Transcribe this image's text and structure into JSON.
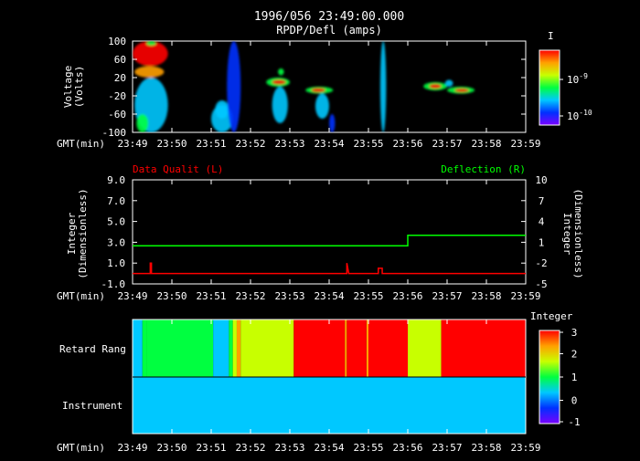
{
  "header": {
    "title": "1996/056 23:49:00.000",
    "subtitle": "RPDP/Defl  (amps)"
  },
  "time_axis": {
    "label": "GMT(min)",
    "ticks": [
      "23:49",
      "23:50",
      "23:51",
      "23:52",
      "23:53",
      "23:54",
      "23:55",
      "23:56",
      "23:57",
      "23:58",
      "23:59"
    ]
  },
  "chart_data": [
    {
      "type": "heatmap",
      "title": "RPDP/Defl  (amps)",
      "ylabel": "Voltage (Volts)",
      "ylabel_lines": [
        "Voltage",
        "(Volts)"
      ],
      "xlabel": "GMT(min)",
      "xlim_minutes": [
        0,
        10
      ],
      "ylim": [
        -100,
        100
      ],
      "yticks": [
        "100",
        "60",
        "20",
        "-20",
        "-60",
        "-100"
      ],
      "colorbar": {
        "label": "I",
        "scale": "log",
        "ticks": [
          {
            "label": "10",
            "exponent": "-9",
            "value": 1e-09
          },
          {
            "label": "10",
            "exponent": "-10",
            "value": 1e-10
          }
        ],
        "colors": [
          "#7a00ff",
          "#0030ff",
          "#00c8ff",
          "#00ff40",
          "#c8ff00",
          "#ffa000",
          "#ff0000"
        ]
      },
      "blobs": [
        {
          "t0": 0.0,
          "t1": 0.9,
          "v0": 45,
          "v1": 100,
          "level": 1.0
        },
        {
          "t0": 0.05,
          "t1": 0.8,
          "v0": 20,
          "v1": 45,
          "level": 0.85
        },
        {
          "t0": 0.05,
          "t1": 0.9,
          "v0": -100,
          "v1": 20,
          "level": 0.25
        },
        {
          "t0": 0.1,
          "t1": 0.4,
          "v0": -100,
          "v1": -60,
          "level": 0.5
        },
        {
          "t0": 0.35,
          "t1": 0.6,
          "v0": 90,
          "v1": 100,
          "level": 0.5
        },
        {
          "t0": 2.0,
          "t1": 2.55,
          "v0": -100,
          "v1": -40,
          "level": 0.4
        },
        {
          "t0": 2.1,
          "t1": 2.45,
          "v0": -70,
          "v1": -30,
          "level": 0.3
        },
        {
          "t0": 2.4,
          "t1": 2.75,
          "v0": -100,
          "v1": 100,
          "level": 0.2
        },
        {
          "t0": 3.4,
          "t1": 4.0,
          "v0": 0,
          "v1": 20,
          "level": 0.5
        },
        {
          "t0": 3.55,
          "t1": 3.9,
          "v0": 5,
          "v1": 15,
          "level": 1.0
        },
        {
          "t0": 3.55,
          "t1": 3.95,
          "v0": -80,
          "v1": 0,
          "level": 0.25
        },
        {
          "t0": 3.7,
          "t1": 3.85,
          "v0": 25,
          "v1": 40,
          "level": 0.45
        },
        {
          "t0": 4.4,
          "t1": 5.1,
          "v0": -15,
          "v1": 0,
          "level": 0.5
        },
        {
          "t0": 4.55,
          "t1": 4.9,
          "v0": -12,
          "v1": -3,
          "level": 1.0
        },
        {
          "t0": 4.65,
          "t1": 5.0,
          "v0": -70,
          "v1": -15,
          "level": 0.25
        },
        {
          "t0": 5.0,
          "t1": 5.15,
          "v0": -100,
          "v1": -60,
          "level": 0.2
        },
        {
          "t0": 6.3,
          "t1": 6.45,
          "v0": -100,
          "v1": 100,
          "level": 0.25
        },
        {
          "t0": 7.4,
          "t1": 8.0,
          "v0": -8,
          "v1": 10,
          "level": 0.5
        },
        {
          "t0": 7.55,
          "t1": 7.85,
          "v0": -4,
          "v1": 6,
          "level": 1.0
        },
        {
          "t0": 8.0,
          "t1": 8.7,
          "v0": -15,
          "v1": 0,
          "level": 0.5
        },
        {
          "t0": 8.2,
          "t1": 8.55,
          "v0": -12,
          "v1": -4,
          "level": 1.0
        },
        {
          "t0": 7.95,
          "t1": 8.15,
          "v0": 0,
          "v1": 15,
          "level": 0.4
        }
      ]
    },
    {
      "type": "line",
      "ylabel_left": "Integer (Dimensionless)",
      "ylabel_left_lines": [
        "Integer",
        "(Dimensionless)"
      ],
      "ylabel_right": "Integer (Dimensionless)",
      "ylabel_right_lines": [
        "Integer",
        "(Dimensionless)"
      ],
      "xlabel": "GMT(min)",
      "ylim_left": [
        -1,
        9
      ],
      "ylim_right": [
        -5,
        10
      ],
      "yticks_left": [
        "9.0",
        "7.0",
        "5.0",
        "3.0",
        "1.0",
        "-1.0"
      ],
      "yticks_right": [
        "10",
        "7",
        "4",
        "1",
        "-2",
        "-5"
      ],
      "series": [
        {
          "name": "Data Qualit (L)",
          "axis": "left",
          "color": "#ff0000",
          "points": [
            [
              0.0,
              0.0
            ],
            [
              0.45,
              0.0
            ],
            [
              0.45,
              1.0
            ],
            [
              0.48,
              1.0
            ],
            [
              0.48,
              0.0
            ],
            [
              5.45,
              0.0
            ],
            [
              5.45,
              1.0
            ],
            [
              5.5,
              0.0
            ],
            [
              6.25,
              0.0
            ],
            [
              6.25,
              0.5
            ],
            [
              6.35,
              0.5
            ],
            [
              6.35,
              0.0
            ],
            [
              10.0,
              0.0
            ]
          ]
        },
        {
          "name": "Deflection  (R)",
          "axis": "right",
          "color": "#00ff00",
          "points": [
            [
              0.0,
              0.5
            ],
            [
              7.0,
              0.5
            ],
            [
              7.0,
              2.0
            ],
            [
              10.0,
              2.0
            ]
          ]
        }
      ]
    },
    {
      "type": "heatmap",
      "rows": [
        "Retard Rang",
        "Instrument"
      ],
      "xlabel": "GMT(min)",
      "colorbar": {
        "label": "Integer",
        "ticks": [
          "3",
          "2",
          "1",
          "0",
          "-1"
        ],
        "range": [
          -1,
          3
        ],
        "colors": [
          "#7a00ff",
          "#0030ff",
          "#00c8ff",
          "#00ff40",
          "#c8ff00",
          "#ffa000",
          "#ff0000"
        ]
      },
      "row_segments": [
        [
          {
            "t0": 0.0,
            "t1": 0.25,
            "value": 0.3
          },
          {
            "t0": 0.25,
            "t1": 0.35,
            "value": 1.2
          },
          {
            "t0": 0.35,
            "t1": 2.05,
            "value": 1.2
          },
          {
            "t0": 2.05,
            "t1": 2.45,
            "value": 0.3
          },
          {
            "t0": 2.45,
            "t1": 2.55,
            "value": 0.8
          },
          {
            "t0": 2.55,
            "t1": 2.65,
            "value": 1.5
          },
          {
            "t0": 2.65,
            "t1": 2.75,
            "value": 2.4
          },
          {
            "t0": 2.75,
            "t1": 4.1,
            "value": 1.9
          },
          {
            "t0": 4.1,
            "t1": 5.4,
            "value": 3.0
          },
          {
            "t0": 5.4,
            "t1": 5.45,
            "value": 2.4
          },
          {
            "t0": 5.45,
            "t1": 5.95,
            "value": 3.0
          },
          {
            "t0": 5.95,
            "t1": 6.0,
            "value": 2.4
          },
          {
            "t0": 6.0,
            "t1": 7.0,
            "value": 3.0
          },
          {
            "t0": 7.0,
            "t1": 7.85,
            "value": 1.9
          },
          {
            "t0": 7.85,
            "t1": 10.0,
            "value": 3.0
          }
        ],
        [
          {
            "t0": 0.0,
            "t1": 10.0,
            "value": 0.0
          }
        ]
      ]
    }
  ],
  "legend": {
    "left": "Data Qualit (L)",
    "right": "Deflection  (R)",
    "left_color": "#ff0000",
    "right_color": "#00ff00"
  }
}
